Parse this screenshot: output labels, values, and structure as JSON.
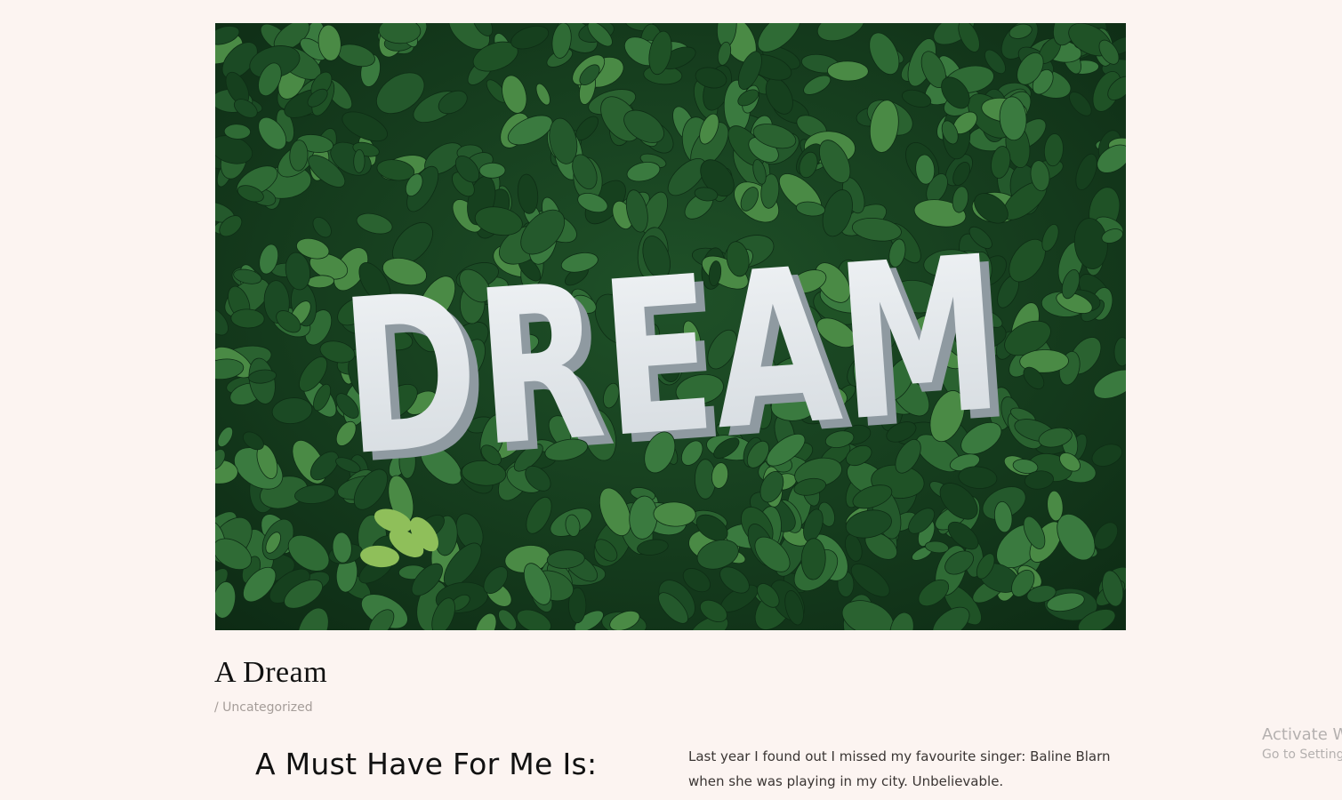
{
  "post": {
    "image_alt": "DREAM",
    "image_text": "DREAM",
    "title": "A Dream",
    "meta_separator": "/",
    "category": "Uncategorized",
    "subheading": "A Must Have For Me Is:",
    "body_line_1": "Last year I found out I missed my favourite singer: Baline Blarn",
    "body_line_2": "when she was playing in my city. Unbelievable."
  },
  "watermark": {
    "line1": "Activate W",
    "line2": "Go to Settings"
  },
  "colors": {
    "page_background": "#fcf4f1",
    "title": "#111111",
    "meta": "#a59d99",
    "foliage_dark": "#163d20",
    "foliage_mid": "#2f6b35",
    "letters": "#e8ecef"
  }
}
